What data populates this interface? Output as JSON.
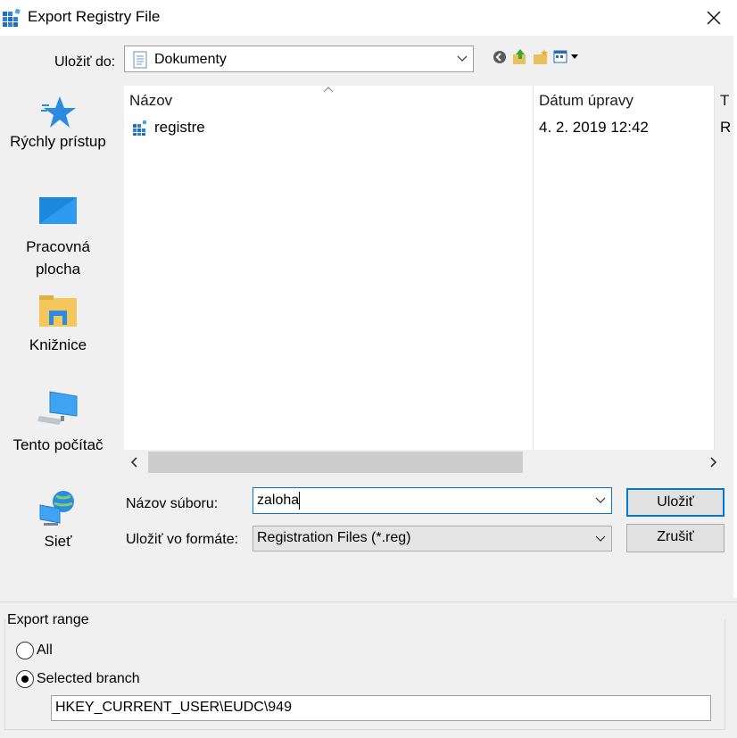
{
  "window": {
    "title": "Export Registry File"
  },
  "location": {
    "label": "Uložiť do:",
    "value": "Dokumenty"
  },
  "toolbar": {
    "icons": [
      "back-icon",
      "up-folder-icon",
      "new-folder-icon",
      "view-menu-icon"
    ]
  },
  "places": [
    {
      "icon": "quick-access-star-icon",
      "label_lines": [
        "Rýchly prístup"
      ]
    },
    {
      "icon": "desktop-icon",
      "label_lines": [
        "Pracovná",
        "plocha"
      ]
    },
    {
      "icon": "libraries-icon",
      "label_lines": [
        "Knižnice"
      ]
    },
    {
      "icon": "this-pc-icon",
      "label_lines": [
        "Tento počítač"
      ]
    },
    {
      "icon": "network-icon",
      "label_lines": [
        "Sieť"
      ]
    }
  ],
  "filelist": {
    "columns": [
      "Názov",
      "Dátum úpravy",
      "T"
    ],
    "rows": [
      {
        "icon": "registry-file-icon",
        "name": "registre",
        "date": "4. 2. 2019 12:42",
        "type": "R"
      }
    ]
  },
  "filename": {
    "label": "Názov súboru:",
    "value": "zaloha"
  },
  "filetype": {
    "label": "Uložiť vo formáte:",
    "value": "Registration Files (*.reg)"
  },
  "buttons": {
    "save": "Uložiť",
    "cancel": "Zrušiť"
  },
  "export_range": {
    "title": "Export range",
    "options": [
      {
        "label": "All",
        "selected": false
      },
      {
        "label": "Selected branch",
        "selected": true
      }
    ],
    "branch_value": "HKEY_CURRENT_USER\\EUDC\\949"
  },
  "colors": {
    "accent": "#0078d7",
    "window_bg": "#f0f0f0",
    "list_bg": "#ffffff"
  }
}
